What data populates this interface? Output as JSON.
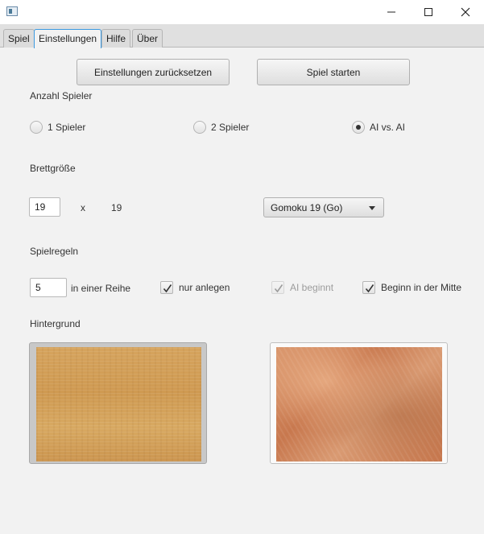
{
  "window": {
    "title": ""
  },
  "tabs": [
    {
      "label": "Spiel"
    },
    {
      "label": "Einstellungen"
    },
    {
      "label": "Hilfe"
    },
    {
      "label": "Über"
    }
  ],
  "buttons": {
    "reset": "Einstellungen zurücksetzen",
    "start": "Spiel starten"
  },
  "players": {
    "heading": "Anzahl Spieler",
    "options": [
      {
        "label": "1 Spieler",
        "selected": false
      },
      {
        "label": "2 Spieler",
        "selected": false
      },
      {
        "label": "AI vs. AI",
        "selected": true
      }
    ]
  },
  "board": {
    "heading": "Brettgröße",
    "width_value": "19",
    "separator": "x",
    "height_value": "19",
    "preset": "Gomoku 19 (Go)"
  },
  "rules": {
    "heading": "Spielregeln",
    "in_a_row_value": "5",
    "in_a_row_label": "in einer Reihe",
    "options": [
      {
        "label": "nur anlegen",
        "checked": true,
        "enabled": true
      },
      {
        "label": "AI beginnt",
        "checked": true,
        "enabled": false
      },
      {
        "label": "Beginn in der Mitte",
        "checked": true,
        "enabled": true
      }
    ]
  },
  "background": {
    "heading": "Hintergrund",
    "images": [
      {
        "name": "light-wood-texture",
        "selected": true
      },
      {
        "name": "burl-wood-texture",
        "selected": false
      }
    ]
  }
}
